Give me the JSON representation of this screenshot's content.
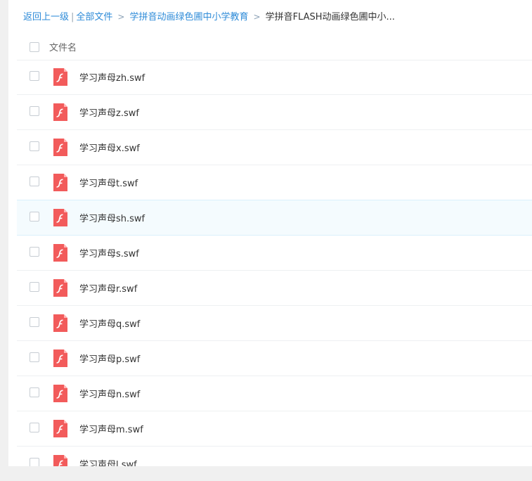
{
  "breadcrumb": {
    "back": "返回上一级",
    "separator": "|",
    "all_files": "全部文件",
    "arrow": ">",
    "folder1": "学拼音动画绿色圃中小学教育",
    "current": "学拼音FLASH动画绿色圃中小..."
  },
  "header": {
    "column_name": "文件名"
  },
  "colors": {
    "link": "#2e8bd8",
    "flash_icon": "#f25b5b",
    "hover_row": "#f4fbfe"
  },
  "files": [
    {
      "name": "学习声母zh.swf",
      "icon": "flash-file-icon"
    },
    {
      "name": "学习声母z.swf",
      "icon": "flash-file-icon"
    },
    {
      "name": "学习声母x.swf",
      "icon": "flash-file-icon"
    },
    {
      "name": "学习声母t.swf",
      "icon": "flash-file-icon"
    },
    {
      "name": "学习声母sh.swf",
      "icon": "flash-file-icon"
    },
    {
      "name": "学习声母s.swf",
      "icon": "flash-file-icon"
    },
    {
      "name": "学习声母r.swf",
      "icon": "flash-file-icon"
    },
    {
      "name": "学习声母q.swf",
      "icon": "flash-file-icon"
    },
    {
      "name": "学习声母p.swf",
      "icon": "flash-file-icon"
    },
    {
      "name": "学习声母n.swf",
      "icon": "flash-file-icon"
    },
    {
      "name": "学习声母m.swf",
      "icon": "flash-file-icon"
    },
    {
      "name": "学习声母l.swf",
      "icon": "flash-file-icon"
    }
  ]
}
